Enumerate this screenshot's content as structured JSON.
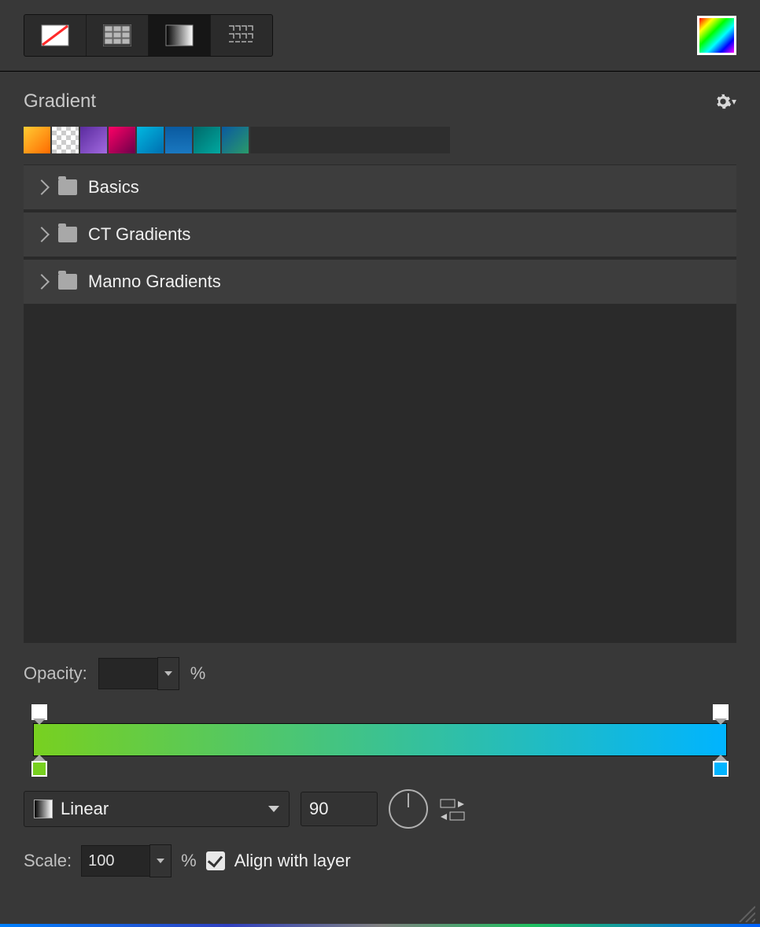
{
  "header": {
    "title": "Gradient"
  },
  "fillTypes": [
    "none",
    "solid",
    "gradient",
    "pattern"
  ],
  "fillTypeSelected": 2,
  "swatches": [
    {
      "bg": "linear-gradient(135deg,#ffcc33,#ff6a00)"
    },
    {
      "bg": "repeating-conic-gradient(#bbb 0 25%,#fff 0 50%) 0/10px 10px"
    },
    {
      "bg": "linear-gradient(135deg,#5a2b9e,#a26ae0)"
    },
    {
      "bg": "linear-gradient(135deg,#ff0066,#6a004a)"
    },
    {
      "bg": "linear-gradient(135deg,#00b8e0,#006eb0)"
    },
    {
      "bg": "linear-gradient(180deg,#0a5aa0,#1a78c0)"
    },
    {
      "bg": "linear-gradient(135deg,#006a6a,#00a8a0)"
    },
    {
      "bg": "linear-gradient(135deg,#0a5aa0,#2a9a6a)"
    }
  ],
  "folders": [
    {
      "name": "Basics"
    },
    {
      "name": "CT Gradients"
    },
    {
      "name": "Manno Gradients"
    }
  ],
  "opacity": {
    "label": "Opacity:",
    "value": "",
    "unit": "%"
  },
  "gradient": {
    "stops": [
      {
        "pos": 0,
        "color": "#78d020",
        "opacity": "#ffffff"
      },
      {
        "pos": 100,
        "color": "#00b4ff",
        "opacity": "#ffffff"
      }
    ],
    "css": "linear-gradient(90deg,#78d020 0%,#00b4ff 100%)"
  },
  "type": {
    "selected": "Linear",
    "angle": "90"
  },
  "scale": {
    "label": "Scale:",
    "value": "100",
    "unit": "%"
  },
  "alignWithLayer": {
    "label": "Align with layer",
    "checked": true
  }
}
